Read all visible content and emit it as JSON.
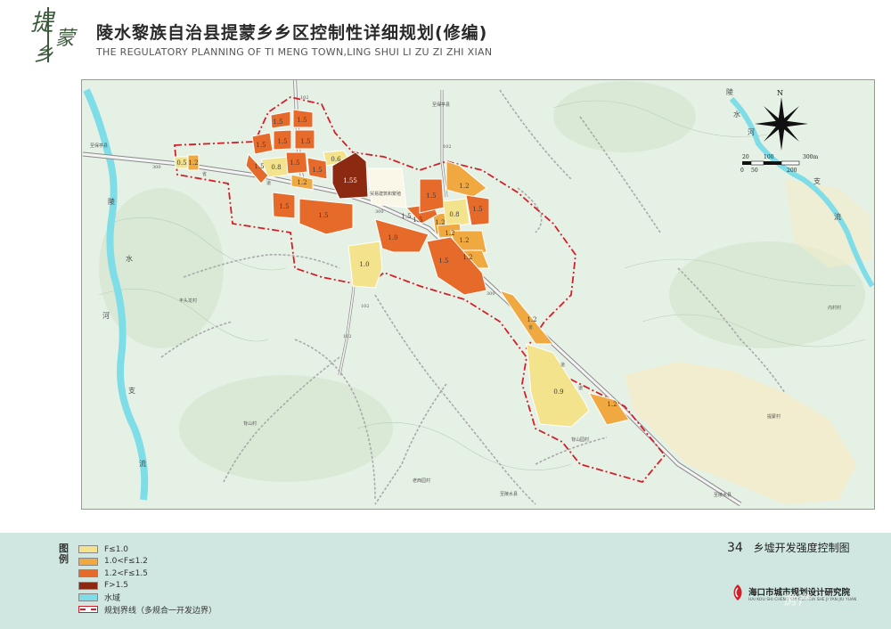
{
  "header": {
    "logo_text": "提蒙乡",
    "title_cn": "陵水黎族自治县提蒙乡乡区控制性详细规划(修编)",
    "title_en": "THE REGULATORY PLANNING OF TI MENG TOWN,LING SHUI LI ZU ZI ZHI XIAN"
  },
  "map": {
    "parcel_labels": [
      {
        "text": "1.5"
      },
      {
        "text": "1.5"
      },
      {
        "text": "1.5"
      },
      {
        "text": "1.5"
      },
      {
        "text": "1.5"
      },
      {
        "text": "1.5"
      },
      {
        "text": "1.5"
      },
      {
        "text": "1.5"
      },
      {
        "text": "0.8"
      },
      {
        "text": "0.6"
      },
      {
        "text": "1.55"
      },
      {
        "text": "0.5"
      },
      {
        "text": "1.2"
      },
      {
        "text": "1.2"
      },
      {
        "text": "1.5"
      },
      {
        "text": "1.5"
      },
      {
        "text": "1.5"
      },
      {
        "text": "1.0"
      },
      {
        "text": "1.0"
      },
      {
        "text": "1.5"
      },
      {
        "text": "1.5"
      },
      {
        "text": "1.2"
      },
      {
        "text": "1.5"
      },
      {
        "text": "0.8"
      },
      {
        "text": "1.5"
      },
      {
        "text": "1.2"
      },
      {
        "text": "1.2"
      },
      {
        "text": "1.2"
      },
      {
        "text": "1.2"
      },
      {
        "text": "0.9"
      },
      {
        "text": "1.2"
      },
      {
        "text": "1.2"
      }
    ],
    "place_labels": {
      "river_ling": "陵",
      "river_shui": "水",
      "river_he": "河",
      "river_zhi": "支",
      "river_liu": "流",
      "river2_ling": "陵",
      "river2_shui": "水",
      "river2_he": "河",
      "river2_zhi": "支",
      "river2_liu": "流",
      "village_1": "丰头龙村",
      "village_2": "背山村",
      "village_3": "老西园村",
      "village_4": "背山园村",
      "village_5": "提蒙村",
      "village_6": "内村村",
      "road_1": "至保亭县",
      "road_2": "至陵水县",
      "road_3": "至保亭县",
      "road_4": "至陵水县",
      "road_num_1": "300",
      "road_num_2": "300",
      "road_num_3": "102",
      "road_num_4": "102",
      "road_num_5": "300",
      "road_num_6": "102",
      "road_num_7": "102",
      "facility": "贸易建筑和繁殖",
      "road_char_1": "省",
      "road_char_2": "道",
      "road_char_3": "省",
      "road_char_4": "道",
      "road_char_5": "道"
    },
    "compass": {
      "north_label": "N"
    },
    "scale": {
      "top_ticks": [
        "20",
        "100",
        "300m"
      ],
      "bottom_ticks": [
        "0",
        "50",
        "200"
      ]
    }
  },
  "legend": {
    "heading": "图例",
    "items": [
      {
        "label": "F≤1.0",
        "color": "#f2e38c"
      },
      {
        "label": "1.0<F≤1.2",
        "color": "#f0a840"
      },
      {
        "label": "1.2<F≤1.5",
        "color": "#e66a2a"
      },
      {
        "label": "F>1.5",
        "color": "#8b2a10"
      },
      {
        "label": "水域",
        "color": "#7fdde8"
      },
      {
        "label": "规划界线（多规合一开发边界）",
        "color": "#d31f2a"
      }
    ]
  },
  "sheet": {
    "number": "34",
    "title": "乡墟开发强度控制图"
  },
  "institute": {
    "name": "海口市城市规划设计研究院",
    "name_en": "HAI KOU SHI CHENG SHI GUI HUA SHE JI YAN JIU YUAN"
  },
  "watermark": "房产"
}
